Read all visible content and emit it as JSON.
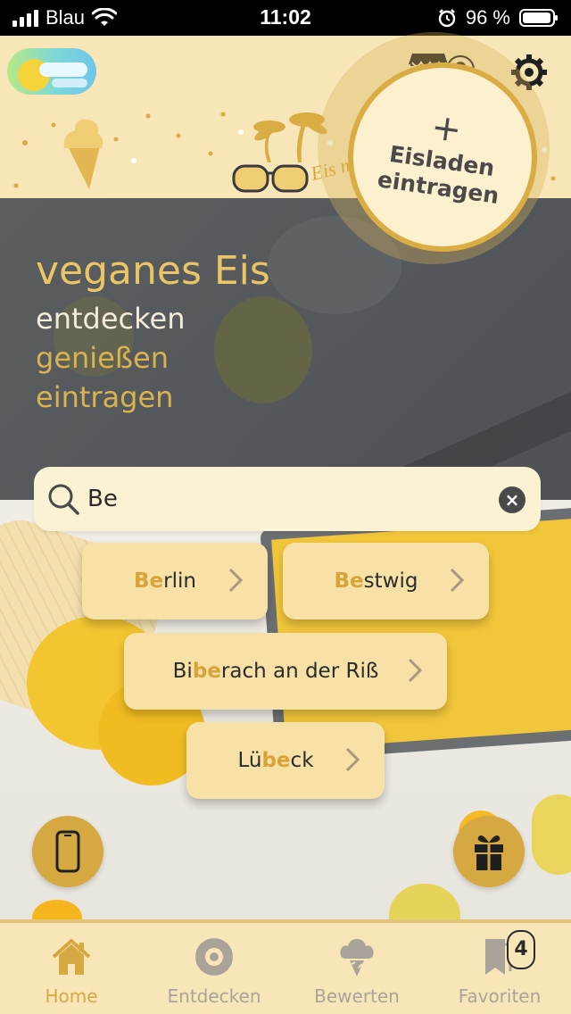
{
  "status_bar": {
    "carrier": "Blau",
    "time": "11:02",
    "battery": "96 %"
  },
  "header": {
    "shop_count": "0",
    "banner_text": "Eis mit Stil"
  },
  "hero": {
    "title": "veganes Eis",
    "line1": "entdecken",
    "line2": "genießen",
    "line3": "eintragen",
    "cta_line1": "Eisladen",
    "cta_line2": "eintragen"
  },
  "search": {
    "value": "Be",
    "placeholder": ""
  },
  "suggestions": [
    {
      "pre": "",
      "hl": "Be",
      "post": "rlin"
    },
    {
      "pre": "",
      "hl": "Be",
      "post": "stwig"
    },
    {
      "pre": "Bi",
      "hl": "be",
      "post": "rach an der Riß"
    },
    {
      "pre": "Lü",
      "hl": "be",
      "post": "ck"
    }
  ],
  "nav": {
    "items": [
      {
        "label": "Home",
        "icon": "home-icon"
      },
      {
        "label": "Entdecken",
        "icon": "target-icon"
      },
      {
        "label": "Bewerten",
        "icon": "ice-cream-cloud-icon"
      },
      {
        "label": "Favoriten",
        "icon": "bookmark-icon"
      }
    ],
    "favorites_count": "4"
  },
  "colors": {
    "accent": "#d6a842",
    "background": "#f8e6b8",
    "chip": "#f7e1a6",
    "highlight": "#d8a43a"
  }
}
